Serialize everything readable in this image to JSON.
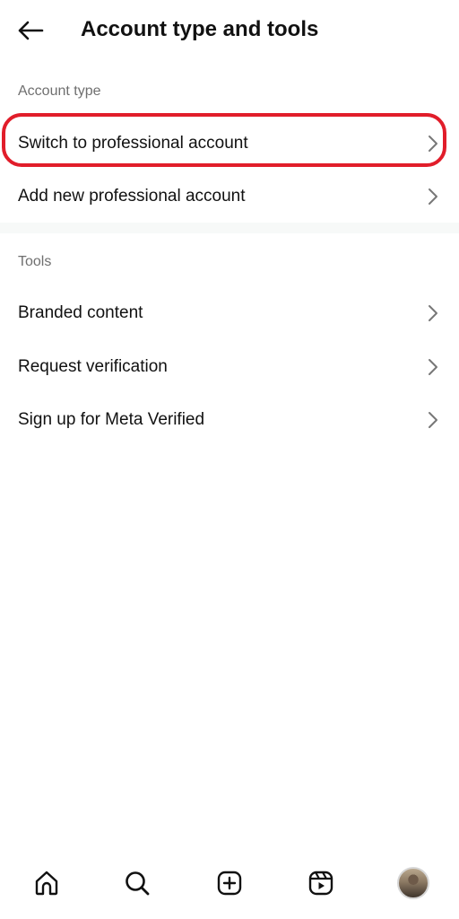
{
  "header": {
    "title": "Account type and tools",
    "back_icon": "arrow-left-icon"
  },
  "sections": {
    "account_type": {
      "label": "Account type",
      "items": [
        {
          "label": "Switch to professional account",
          "highlighted": true
        },
        {
          "label": "Add new professional account"
        }
      ]
    },
    "tools": {
      "label": "Tools",
      "items": [
        {
          "label": "Branded content"
        },
        {
          "label": "Request verification"
        },
        {
          "label": "Sign up for Meta Verified"
        }
      ]
    }
  },
  "bottom_nav": {
    "items": [
      "home-icon",
      "search-icon",
      "create-icon",
      "reels-icon",
      "profile-avatar"
    ]
  },
  "colors": {
    "highlight": "#e11d2a",
    "text": "#111111",
    "secondary_text": "#6f6f6f"
  }
}
